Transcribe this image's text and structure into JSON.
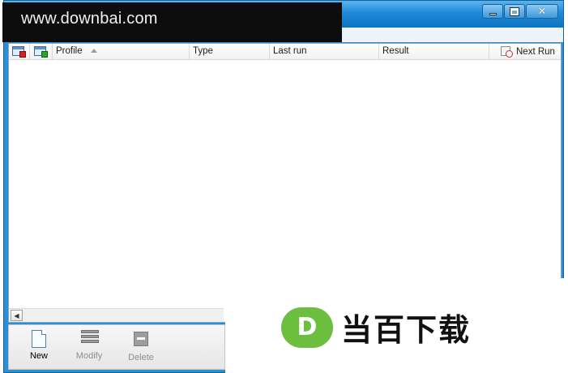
{
  "watermark": {
    "text": "www.downbai.com"
  },
  "window": {
    "caption_buttons": {
      "minimize": "minimize",
      "maximize": "maximize",
      "close": "✕"
    }
  },
  "list": {
    "columns": [
      {
        "key": "status_icon_stop",
        "label": ""
      },
      {
        "key": "status_icon_run",
        "label": ""
      },
      {
        "key": "profile",
        "label": "Profile",
        "sorted": "ascending"
      },
      {
        "key": "type",
        "label": "Type"
      },
      {
        "key": "last_run",
        "label": "Last run"
      },
      {
        "key": "result",
        "label": "Result"
      },
      {
        "key": "next_run",
        "label": "Next Run"
      }
    ],
    "rows": []
  },
  "toolbar": {
    "new_label": "New",
    "modify_label": "Modify",
    "delete_label": "Delete"
  },
  "brand": {
    "logo_letter": "D",
    "text": "当百下载",
    "color": "#6cbe3f"
  }
}
